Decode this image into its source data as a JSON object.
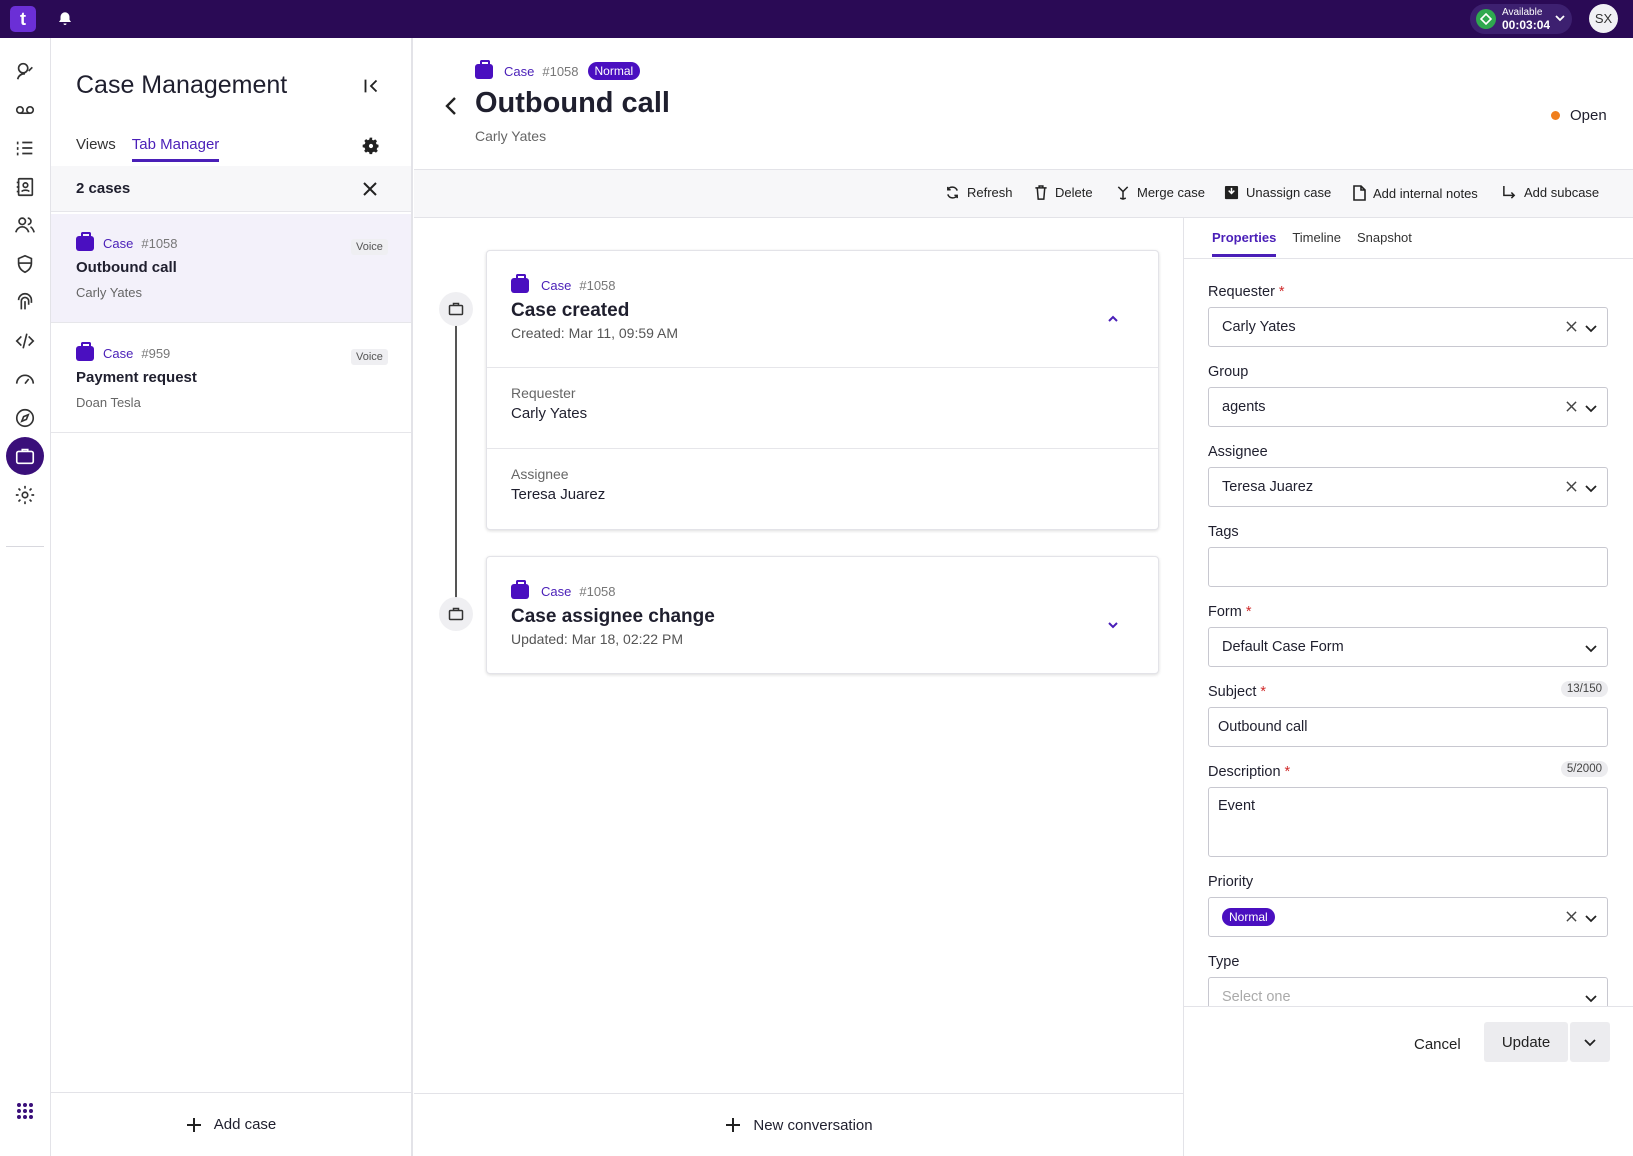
{
  "topbar": {
    "logo_text": "t",
    "status_label": "Available",
    "status_timer": "00:03:04",
    "avatar_initials": "SX",
    "colors": {
      "bar": "#2a0a55",
      "accent": "#4a0fc0",
      "available": "#2fa84f"
    }
  },
  "rail": {
    "items": [
      "contacts-icon",
      "voicemail-icon",
      "list-icon",
      "address-book-icon",
      "people-icon",
      "shield-icon",
      "fingerprint-icon",
      "code-icon",
      "gauge-icon",
      "compass-icon",
      "briefcase-icon",
      "gear-icon"
    ],
    "active": "briefcase-icon",
    "bottom": "apps-grid-icon"
  },
  "panel": {
    "title": "Case Management",
    "tabs": [
      {
        "label": "Views"
      },
      {
        "label": "Tab Manager"
      }
    ],
    "active_tab": "Tab Manager",
    "count": "2 cases",
    "cases": [
      {
        "type": "Case",
        "number": "#1058",
        "badge": "Voice",
        "title": "Outbound call",
        "subtitle": "Carly Yates"
      },
      {
        "type": "Case",
        "number": "#959",
        "badge": "Voice",
        "title": "Payment request",
        "subtitle": "Doan Tesla"
      }
    ],
    "add_case": "Add case"
  },
  "header": {
    "type": "Case",
    "number": "#1058",
    "priority": "Normal",
    "title": "Outbound call",
    "subtitle": "Carly Yates",
    "status": "Open"
  },
  "toolbar": {
    "refresh": "Refresh",
    "delete": "Delete",
    "merge": "Merge case",
    "unassign": "Unassign case",
    "notes": "Add internal notes",
    "subcase": "Add subcase"
  },
  "timeline": [
    {
      "type": "Case",
      "number": "#1058",
      "title": "Case created",
      "subtitle": "Created: Mar 11, 09:59 AM",
      "expanded": true,
      "rows": [
        {
          "label": "Requester",
          "value": "Carly Yates"
        },
        {
          "label": "Assignee",
          "value": "Teresa Juarez"
        }
      ]
    },
    {
      "type": "Case",
      "number": "#1058",
      "title": "Case assignee change",
      "subtitle": "Updated: Mar 18, 02:22 PM",
      "expanded": false
    }
  ],
  "new_conversation": "New conversation",
  "properties": {
    "tabs": [
      {
        "label": "Properties"
      },
      {
        "label": "Timeline"
      },
      {
        "label": "Snapshot"
      }
    ],
    "active_tab": "Properties",
    "requester": {
      "label": "Requester",
      "value": "Carly Yates"
    },
    "group": {
      "label": "Group",
      "value": "agents"
    },
    "assignee": {
      "label": "Assignee",
      "value": "Teresa Juarez"
    },
    "tags": {
      "label": "Tags",
      "value": ""
    },
    "form": {
      "label": "Form",
      "value": "Default Case Form"
    },
    "subject": {
      "label": "Subject",
      "value": "Outbound call",
      "counter": "13/150"
    },
    "description": {
      "label": "Description",
      "value": "Event",
      "counter": "5/2000"
    },
    "priority": {
      "label": "Priority",
      "value": "Normal"
    },
    "type": {
      "label": "Type",
      "placeholder": "Select one"
    },
    "required_mark": "*",
    "cancel": "Cancel",
    "update": "Update"
  }
}
